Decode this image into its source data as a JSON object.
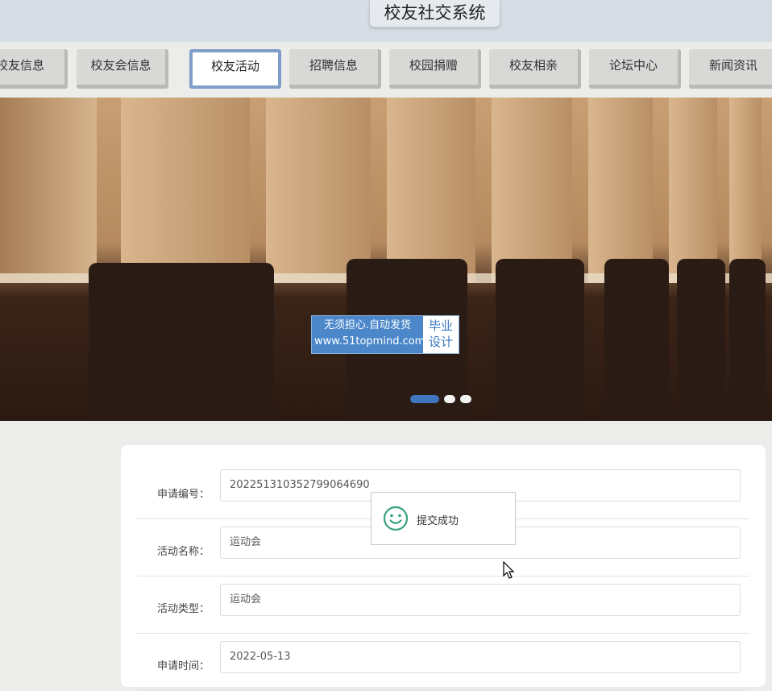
{
  "header": {
    "title": "校友社交系统"
  },
  "nav": {
    "items": [
      {
        "label": "校友信息",
        "active": false
      },
      {
        "label": "校友会信息",
        "active": false
      },
      {
        "label": "校友活动",
        "active": true
      },
      {
        "label": "招聘信息",
        "active": false
      },
      {
        "label": "校园捐赠",
        "active": false
      },
      {
        "label": "校友相亲",
        "active": false
      },
      {
        "label": "论坛中心",
        "active": false
      },
      {
        "label": "新闻资讯",
        "active": false
      }
    ]
  },
  "banner": {
    "watermark": {
      "line1": "无须担心.自动发货",
      "line2": "www.51topmind.com",
      "tag_line1": "毕业",
      "tag_line2": "设计"
    },
    "slides": {
      "count": 3,
      "active_index": 0
    }
  },
  "form": {
    "fields": [
      {
        "label": "申请编号：",
        "value": "202251310352799064690"
      },
      {
        "label": "活动名称：",
        "value": "运动会"
      },
      {
        "label": "活动类型：",
        "value": "运动会"
      },
      {
        "label": "申请时间：",
        "value": "2022-05-13"
      }
    ]
  },
  "toast": {
    "message": "提交成功",
    "icon": "smile-icon"
  },
  "colors": {
    "accent": "#3f76bd",
    "nav_active_border": "#7f9fc8",
    "success": "#3aa27a"
  }
}
